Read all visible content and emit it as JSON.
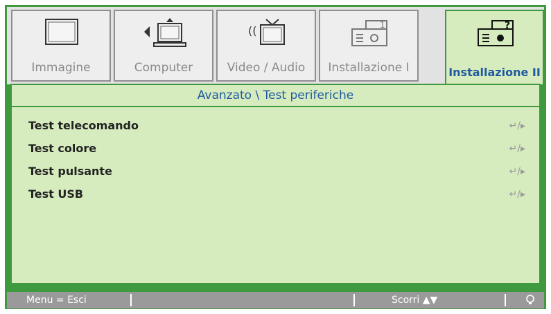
{
  "tabs": [
    {
      "label": "Immagine",
      "icon": "monitor-icon"
    },
    {
      "label": "Computer",
      "icon": "computer-icon"
    },
    {
      "label": "Video / Audio",
      "icon": "video-audio-icon"
    },
    {
      "label": "Installazione I",
      "icon": "projector-icon"
    },
    {
      "label": "Installazione II",
      "icon": "projector-question-icon"
    }
  ],
  "active_tab": "Installazione II",
  "breadcrumb": "Avanzato \\ Test periferiche",
  "items": [
    {
      "label": "Test telecomando",
      "action": "↵/▸"
    },
    {
      "label": "Test colore",
      "action": "↵/▸"
    },
    {
      "label": "Test pulsante",
      "action": "↵/▸"
    },
    {
      "label": "Test USB",
      "action": "↵/▸"
    }
  ],
  "footer": {
    "menu_hint": "Menu = Esci",
    "scroll_hint": "Scorri ▲▼",
    "lamp_icon": "lightbulb-icon"
  },
  "colors": {
    "accent_green": "#3f9a3f",
    "panel_green": "#d6ecbe",
    "title_blue": "#1f5aa0",
    "footer_gray": "#9a9a9a"
  }
}
